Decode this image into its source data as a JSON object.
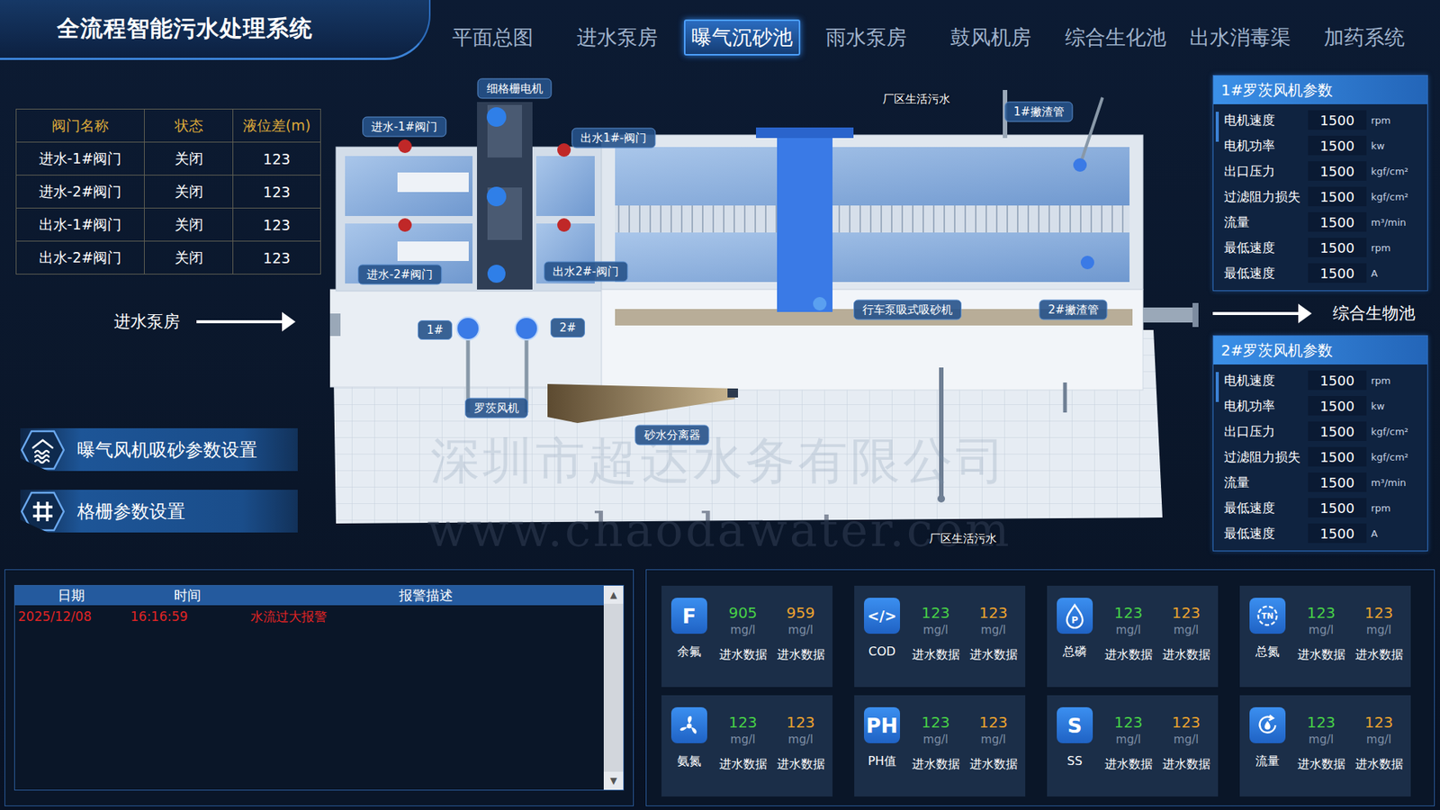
{
  "header": {
    "title": "全流程智能污水处理系统"
  },
  "tabs": [
    {
      "label": "平面总图",
      "selected": false
    },
    {
      "label": "进水泵房",
      "selected": false
    },
    {
      "label": "曝气沉砂池",
      "selected": true
    },
    {
      "label": "雨水泵房",
      "selected": false
    },
    {
      "label": "鼓风机房",
      "selected": false
    },
    {
      "label": "综合生化池",
      "selected": false
    },
    {
      "label": "出水消毒渠",
      "selected": false
    },
    {
      "label": "加药系统",
      "selected": false
    }
  ],
  "valve_table": {
    "columns": [
      "阀门名称",
      "状态",
      "液位差(m)"
    ],
    "rows": [
      [
        "进水-1#阀门",
        "关闭",
        "123"
      ],
      [
        "进水-2#阀门",
        "关闭",
        "123"
      ],
      [
        "出水-1#阀门",
        "关闭",
        "123"
      ],
      [
        "出水-2#阀门",
        "关闭",
        "123"
      ]
    ]
  },
  "flow_in": {
    "label": "进水泵房"
  },
  "flow_out": {
    "label": "综合生物池"
  },
  "settings_buttons": [
    {
      "label": "曝气风机吸砂参数设置",
      "kind": "blower"
    },
    {
      "label": "格栅参数设置",
      "kind": "grid"
    }
  ],
  "diagram": {
    "labels": [
      {
        "text": "细格栅电机",
        "kind": "tag"
      },
      {
        "text": "进水-1#阀门",
        "kind": "tag"
      },
      {
        "text": "出水1#-阀门",
        "kind": "tag"
      },
      {
        "text": "进水-2#阀门",
        "kind": "tag"
      },
      {
        "text": "出水2#-阀门",
        "kind": "tag"
      },
      {
        "text": "厂区生活污水",
        "kind": "plain"
      },
      {
        "text": "1#撇渣管",
        "kind": "tag"
      },
      {
        "text": "行车泵吸式吸砂机",
        "kind": "tag"
      },
      {
        "text": "2#撇渣管",
        "kind": "tag"
      },
      {
        "text": "1#",
        "kind": "tag"
      },
      {
        "text": "2#",
        "kind": "tag"
      },
      {
        "text": "罗茨风机",
        "kind": "tag"
      },
      {
        "text": "砂水分离器",
        "kind": "tag"
      },
      {
        "text": "厂区生活污水",
        "kind": "plain"
      }
    ]
  },
  "watermark": {
    "lines": [
      "深圳市超达水务有限公司",
      "www.chaodawater.com"
    ]
  },
  "blower_panels": [
    {
      "title": "1#罗茨风机参数",
      "rows": [
        {
          "label": "电机速度",
          "value": "1500",
          "unit": "rpm"
        },
        {
          "label": "电机功率",
          "value": "1500",
          "unit": "kw"
        },
        {
          "label": "出口压力",
          "value": "1500",
          "unit": "kgf/cm²"
        },
        {
          "label": "过滤阻力损失",
          "value": "1500",
          "unit": "kgf/cm²"
        },
        {
          "label": "流量",
          "value": "1500",
          "unit": "m³/min"
        },
        {
          "label": "最低速度",
          "value": "1500",
          "unit": "rpm"
        },
        {
          "label": "最低速度",
          "value": "1500",
          "unit": "A"
        }
      ]
    },
    {
      "title": "2#罗茨风机参数",
      "rows": [
        {
          "label": "电机速度",
          "value": "1500",
          "unit": "rpm"
        },
        {
          "label": "电机功率",
          "value": "1500",
          "unit": "kw"
        },
        {
          "label": "出口压力",
          "value": "1500",
          "unit": "kgf/cm²"
        },
        {
          "label": "过滤阻力损失",
          "value": "1500",
          "unit": "kgf/cm²"
        },
        {
          "label": "流量",
          "value": "1500",
          "unit": "m³/min"
        },
        {
          "label": "最低速度",
          "value": "1500",
          "unit": "rpm"
        },
        {
          "label": "最低速度",
          "value": "1500",
          "unit": "A"
        }
      ]
    }
  ],
  "alarm_table": {
    "columns": [
      "日期",
      "时间",
      "报警描述"
    ],
    "rows": [
      {
        "date": "2025/12/08",
        "time": "16:16:59",
        "description": "水流过大报警",
        "severity": "alarm"
      }
    ],
    "scroll_up": "▲",
    "scroll_down": "▼"
  },
  "metrics": [
    {
      "name": "余氟",
      "kind": "letter",
      "glyph": "F",
      "values": [
        {
          "value": "905",
          "unit": "mg/l",
          "label": "进水数据"
        },
        {
          "value": "959",
          "unit": "mg/l",
          "label": "进水数据"
        }
      ]
    },
    {
      "name": "COD",
      "kind": "letter",
      "glyph": "</>",
      "values": [
        {
          "value": "123",
          "unit": "mg/l",
          "label": "进水数据"
        },
        {
          "value": "123",
          "unit": "mg/l",
          "label": "进水数据"
        }
      ]
    },
    {
      "name": "总磷",
      "kind": "drop",
      "glyph": "P",
      "values": [
        {
          "value": "123",
          "unit": "mg/l",
          "label": "进水数据"
        },
        {
          "value": "123",
          "unit": "mg/l",
          "label": "进水数据"
        }
      ]
    },
    {
      "name": "总氮",
      "kind": "ring",
      "glyph": "TN",
      "values": [
        {
          "value": "123",
          "unit": "mg/l",
          "label": "进水数据"
        },
        {
          "value": "123",
          "unit": "mg/l",
          "label": "进水数据"
        }
      ]
    },
    {
      "name": "氨氮",
      "kind": "fan",
      "glyph": "",
      "values": [
        {
          "value": "123",
          "unit": "mg/l",
          "label": "进水数据"
        },
        {
          "value": "123",
          "unit": "mg/l",
          "label": "进水数据"
        }
      ]
    },
    {
      "name": "PH值",
      "kind": "letter",
      "glyph": "PH",
      "values": [
        {
          "value": "123",
          "unit": "mg/l",
          "label": "进水数据"
        },
        {
          "value": "123",
          "unit": "mg/l",
          "label": "进水数据"
        }
      ]
    },
    {
      "name": "SS",
      "kind": "letter",
      "glyph": "S",
      "values": [
        {
          "value": "123",
          "unit": "mg/l",
          "label": "进水数据"
        },
        {
          "value": "123",
          "unit": "mg/l",
          "label": "进水数据"
        }
      ]
    },
    {
      "name": "流量",
      "kind": "cycle",
      "glyph": "",
      "values": [
        {
          "value": "123",
          "unit": "mg/l",
          "label": "进水数据"
        },
        {
          "value": "123",
          "unit": "mg/l",
          "label": "进水数据"
        }
      ]
    }
  ]
}
